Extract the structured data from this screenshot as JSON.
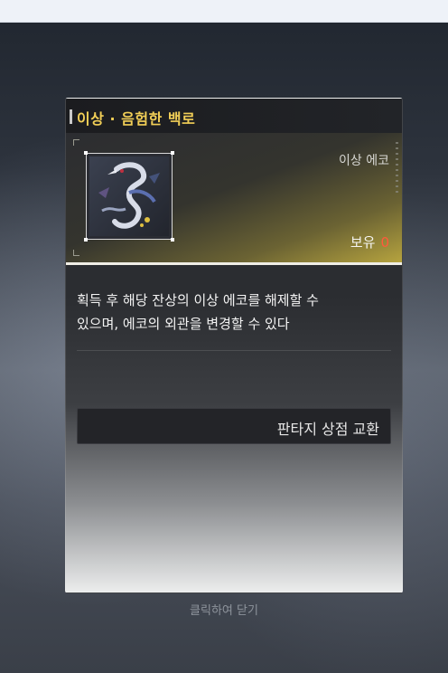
{
  "card": {
    "title": "이상 · 음험한 백로",
    "item_type": "이상 에코",
    "owned_label": "보유",
    "owned_count": "0",
    "description_line1": "획득 후 해당 잔상의 이상 에코를 해제할 수",
    "description_line2": "있으며, 에코의 외관을 변경할 수 있다",
    "exchange_button_label": "판타지 상점 교환"
  },
  "close_hint": "클릭하여 닫기",
  "colors": {
    "title": "#f2cf57",
    "owned_count": "#ff5a3c",
    "banner_accent": "#b9a63f"
  },
  "icons": {
    "item_art": "heron-creature-portrait"
  }
}
